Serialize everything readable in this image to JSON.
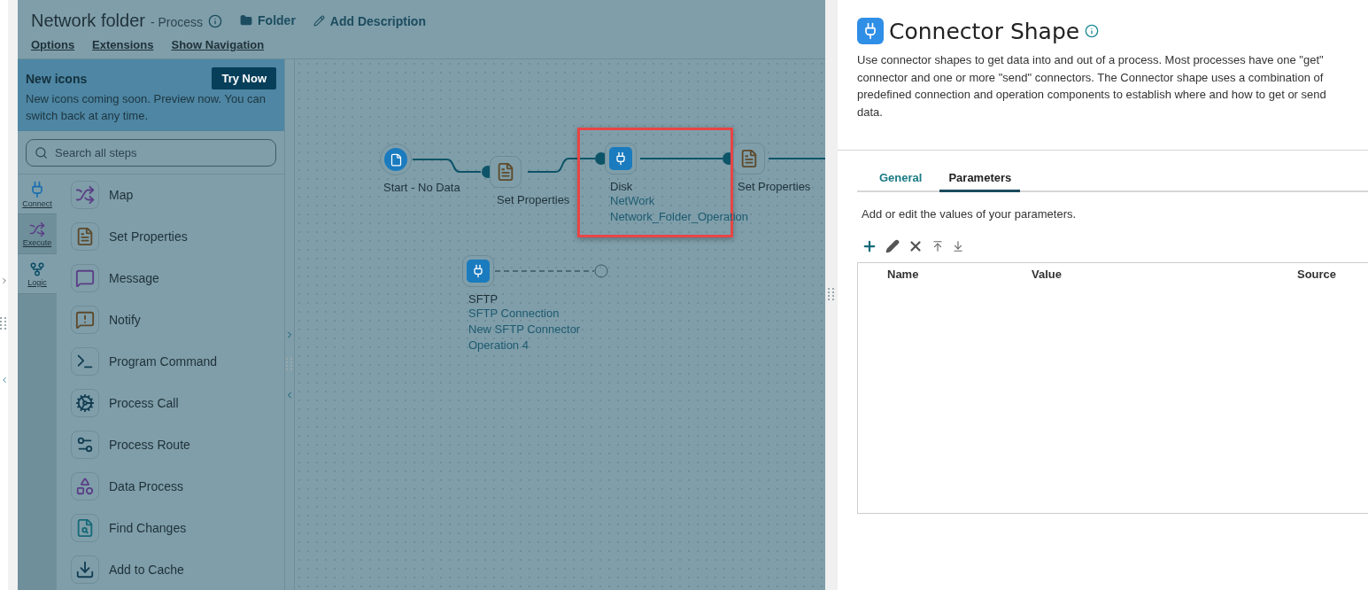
{
  "header": {
    "title": "Network folder",
    "subtitle": "- Process",
    "actions": [
      {
        "kind": "folder",
        "label": "Folder"
      },
      {
        "kind": "edit",
        "label": "Add Description"
      }
    ],
    "links": [
      "Options",
      "Extensions",
      "Show Navigation"
    ]
  },
  "banner": {
    "title": "New icons",
    "button": "Try Now",
    "text": "New icons coming soon. Preview now. You can switch back at any time."
  },
  "search": {
    "placeholder": "Search all steps"
  },
  "categories": [
    {
      "kind": "connect",
      "label": "Connect",
      "selected": false
    },
    {
      "kind": "execute",
      "label": "Execute",
      "selected": true
    },
    {
      "kind": "logic",
      "label": "Logic",
      "selected": false
    }
  ],
  "steps": [
    {
      "kind": "map",
      "label": "Map"
    },
    {
      "kind": "properties",
      "label": "Set Properties"
    },
    {
      "kind": "message",
      "label": "Message"
    },
    {
      "kind": "notify",
      "label": "Notify"
    },
    {
      "kind": "command",
      "label": "Program Command"
    },
    {
      "kind": "call",
      "label": "Process Call"
    },
    {
      "kind": "route",
      "label": "Process Route"
    },
    {
      "kind": "data",
      "label": "Data Process"
    },
    {
      "kind": "find",
      "label": "Find Changes"
    },
    {
      "kind": "cache",
      "label": "Add to Cache"
    }
  ],
  "canvas": {
    "nodes": [
      {
        "kind": "start",
        "title": "Start - No Data",
        "selected": false
      },
      {
        "kind": "properties",
        "title": "Set Properties",
        "selected": false
      },
      {
        "kind": "connector",
        "title": "Disk",
        "details": [
          "NetWork",
          "Network_Folder_Operation"
        ],
        "selected": true
      },
      {
        "kind": "properties",
        "title": "Set Properties",
        "selected": false
      },
      {
        "kind": "connector",
        "title": "SFTP",
        "details": [
          "SFTP Connection",
          "New SFTP Connector",
          "Operation 4"
        ],
        "selected": false
      }
    ]
  },
  "panel": {
    "title": "Connector Shape",
    "description": "Use connector shapes to get data into and out of a process. Most processes have one \"get\" connector and one or more \"send\" connectors. The Connector shape uses a combination of predefined connection and operation components to establish where and how to get or send data.",
    "tabs": [
      {
        "label": "General",
        "selected": false
      },
      {
        "label": "Parameters",
        "selected": true
      }
    ],
    "hint": "Add or edit the values of your parameters.",
    "columns": [
      "Name",
      "Value",
      "Source"
    ]
  }
}
